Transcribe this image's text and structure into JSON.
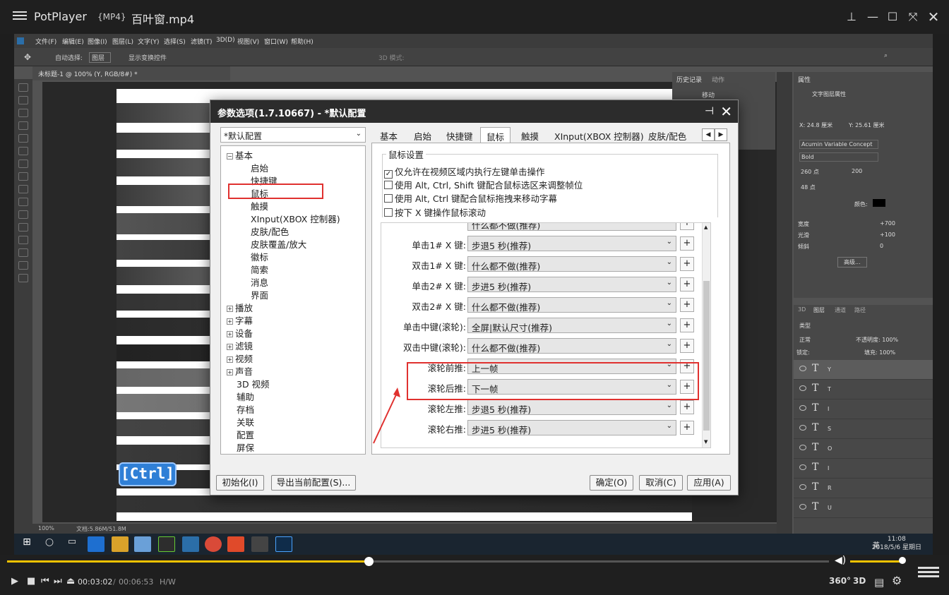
{
  "potplayer": {
    "app_name": "PotPlayer",
    "format": "{MP4}",
    "filename": "百叶窗.mp4",
    "time_current": "00:03:02",
    "time_separator": "/",
    "time_total": "00:06:53",
    "decode_mode": "H/W",
    "btn_360": "360°",
    "btn_3d": "3D",
    "seek_progress_fraction": 0.44,
    "volume_fraction": 1.0
  },
  "photoshop": {
    "menu": [
      "文件(F)",
      "编辑(E)",
      "图像(I)",
      "图层(L)",
      "文字(Y)",
      "选择(S)",
      "滤镜(T)",
      "3D(D)",
      "视图(V)",
      "窗口(W)",
      "帮助(H)"
    ],
    "opts_auto_select": "自动选择:",
    "opts_layer": "图层",
    "opts_transform": "显示变换控件",
    "opts_3d": "3D 模式:",
    "doc_tab": "未标题-1 @ 100% (Y, RGB/8#) *",
    "status_zoom": "100%",
    "status_doc": "文档:5.86M/51.8M",
    "hist_tab1": "历史记录",
    "hist_tab2": "动作",
    "hist_item": "移动",
    "props_title": "属性",
    "props_subtitle": "文字图层属性",
    "props_x": "X: 24.8 厘米",
    "props_y": "Y: 25.61 厘米",
    "props_font": "Acumin Variable Concept",
    "props_weight": "Bold",
    "props_size": "260 点",
    "props_tracking": "200",
    "props_leading": "48 点",
    "props_color_label": "颜色:",
    "props_width_label": "宽度",
    "props_width_val": "+700",
    "props_slant_label": "光滑",
    "props_slant_val": "+100",
    "props_tilt_label": "倾斜",
    "props_tilt_val": "0",
    "props_adv": "高级...",
    "layers_tabs": [
      "3D",
      "图层",
      "通道",
      "路径"
    ],
    "layers_kind": "类型",
    "layers_mode": "正常",
    "layers_opacity": "不透明度: 100%",
    "layers_lock": "锁定:",
    "layers_fill": "填充: 100%",
    "layers": [
      "Y",
      "T",
      "I",
      "S",
      "O",
      "I",
      "R",
      "U"
    ],
    "ctrl_badge": "[Ctrl]"
  },
  "taskbar": {
    "time": "11:08",
    "date": "2018/5/6 星期日",
    "ime": "英"
  },
  "dialog": {
    "title": "参数选项(1.7.10667) - *默认配置",
    "profile": "*默认配置",
    "tree": [
      {
        "label": "基本",
        "level": 0,
        "sign": "−"
      },
      {
        "label": "启始",
        "level": 1
      },
      {
        "label": "快捷键",
        "level": 1
      },
      {
        "label": "鼠标",
        "level": 1
      },
      {
        "label": "触摸",
        "level": 1
      },
      {
        "label": "XInput(XBOX 控制器)",
        "level": 1
      },
      {
        "label": "皮肤/配色",
        "level": 1
      },
      {
        "label": "皮肤覆盖/放大",
        "level": 1
      },
      {
        "label": "徽标",
        "level": 1
      },
      {
        "label": "简索",
        "level": 1
      },
      {
        "label": "消息",
        "level": 1
      },
      {
        "label": "界面",
        "level": 1
      },
      {
        "label": "播放",
        "level": 0,
        "sign": "+"
      },
      {
        "label": "字幕",
        "level": 0,
        "sign": "+"
      },
      {
        "label": "设备",
        "level": 0,
        "sign": "+"
      },
      {
        "label": "滤镜",
        "level": 0,
        "sign": "+"
      },
      {
        "label": "视频",
        "level": 0,
        "sign": "+"
      },
      {
        "label": "声音",
        "level": 0,
        "sign": "+"
      },
      {
        "label": "3D 视频",
        "level": 0
      },
      {
        "label": "辅助",
        "level": 0
      },
      {
        "label": "存档",
        "level": 0
      },
      {
        "label": "关联",
        "level": 0
      },
      {
        "label": "配置",
        "level": 0
      },
      {
        "label": "屏保",
        "level": 0
      }
    ],
    "tabs": [
      "基本",
      "启始",
      "快捷键",
      "鼠标",
      "触摸",
      "XInput(XBOX 控制器)",
      "皮肤/配色"
    ],
    "active_tab": "鼠标",
    "group_title": "鼠标设置",
    "checkboxes": [
      {
        "label": "仅允许在视频区域内执行左键单击操作",
        "checked": true
      },
      {
        "label": "使用 Alt, Ctrl, Shift 键配合鼠标选区来调整帧位",
        "checked": false
      },
      {
        "label": "使用 Alt, Ctrl 键配合鼠标拖拽来移动字幕",
        "checked": false
      },
      {
        "label": "按下 X 键操作鼠标滚动",
        "checked": false
      }
    ],
    "rows": [
      {
        "label": "",
        "value": "什么都不做(推荐)"
      },
      {
        "label": "单击1# X 键:",
        "value": "步退5 秒(推荐)"
      },
      {
        "label": "双击1# X 键:",
        "value": "什么都不做(推荐)"
      },
      {
        "label": "单击2# X 键:",
        "value": "步进5 秒(推荐)"
      },
      {
        "label": "双击2# X 键:",
        "value": "什么都不做(推荐)"
      },
      {
        "label": "单击中键(滚轮):",
        "value": "全屏|默认尺寸(推荐)"
      },
      {
        "label": "双击中键(滚轮):",
        "value": "什么都不做(推荐)"
      },
      {
        "label": "滚轮前推:",
        "value": "上一帧"
      },
      {
        "label": "滚轮后推:",
        "value": "下一帧"
      },
      {
        "label": "滚轮左推:",
        "value": "步退5 秒(推荐)"
      },
      {
        "label": "滚轮右推:",
        "value": "步进5 秒(推荐)"
      }
    ],
    "plus": "+",
    "btn_reset": "初始化(I)",
    "btn_export": "导出当前配置(S)...",
    "btn_ok": "确定(O)",
    "btn_cancel": "取消(C)",
    "btn_apply": "应用(A)"
  }
}
